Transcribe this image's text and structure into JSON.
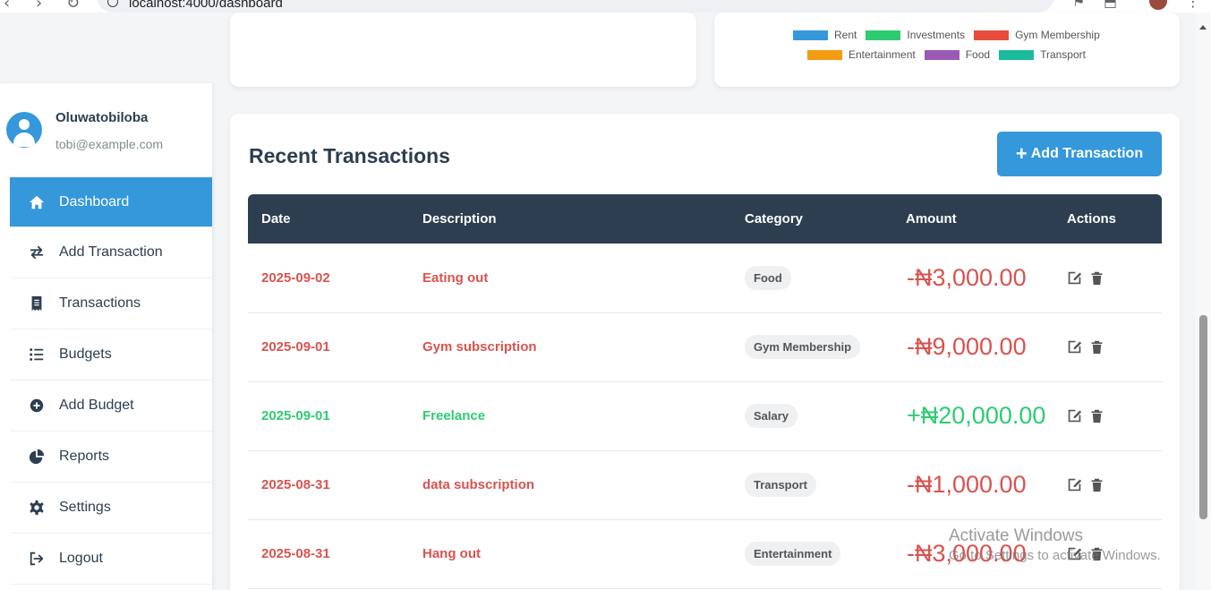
{
  "browser": {
    "url": "localhost:4000/dashboard"
  },
  "chart_legend": {
    "row1": [
      {
        "label": "Rent",
        "color": "#3498db"
      },
      {
        "label": "Investments",
        "color": "#2ecc71"
      },
      {
        "label": "Gym Membership",
        "color": "#e74c3c"
      }
    ],
    "row2": [
      {
        "label": "Entertainment",
        "color": "#f39c12"
      },
      {
        "label": "Food",
        "color": "#9b59b6"
      },
      {
        "label": "Transport",
        "color": "#1abc9c"
      }
    ]
  },
  "user": {
    "name": "Oluwatobiloba",
    "email": "tobi@example.com"
  },
  "sidebar": {
    "items": [
      {
        "label": "Dashboard",
        "icon": "home-icon",
        "active": true
      },
      {
        "label": "Add Transaction",
        "icon": "exchange-icon",
        "active": false
      },
      {
        "label": "Transactions",
        "icon": "receipt-icon",
        "active": false
      },
      {
        "label": "Budgets",
        "icon": "list-icon",
        "active": false
      },
      {
        "label": "Add Budget",
        "icon": "plus-circle-icon",
        "active": false
      },
      {
        "label": "Reports",
        "icon": "pie-chart-icon",
        "active": false
      },
      {
        "label": "Settings",
        "icon": "gear-icon",
        "active": false
      },
      {
        "label": "Logout",
        "icon": "logout-icon",
        "active": false
      }
    ]
  },
  "transactions": {
    "title": "Recent Transactions",
    "add_button": "Add Transaction",
    "columns": [
      "Date",
      "Description",
      "Category",
      "Amount",
      "Actions"
    ],
    "rows": [
      {
        "date": "2025-09-02",
        "description": "Eating out",
        "category": "Food",
        "amount": "-₦3,000.00",
        "type": "expense"
      },
      {
        "date": "2025-09-01",
        "description": "Gym subscription",
        "category": "Gym Membership",
        "amount": "-₦9,000.00",
        "type": "expense"
      },
      {
        "date": "2025-09-01",
        "description": "Freelance",
        "category": "Salary",
        "amount": "+₦20,000.00",
        "type": "income"
      },
      {
        "date": "2025-08-31",
        "description": "data subscription",
        "category": "Transport",
        "amount": "-₦1,000.00",
        "type": "expense"
      },
      {
        "date": "2025-08-31",
        "description": "Hang out",
        "category": "Entertainment",
        "amount": "-₦3,000.00",
        "type": "expense"
      }
    ]
  },
  "watermark": {
    "title": "Activate Windows",
    "subtitle": "Go to Settings to activate Windows."
  }
}
